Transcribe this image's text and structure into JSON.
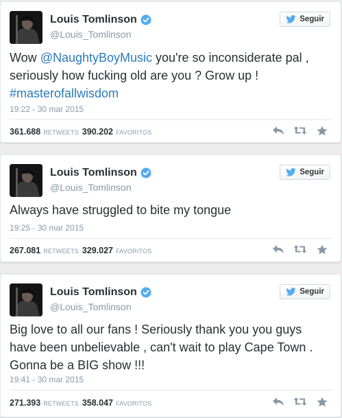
{
  "colors": {
    "link": "#2b7bb9",
    "verified_badge": "#55acee",
    "bird_icon": "#55acee",
    "muted_text": "#8899a6",
    "action_icons": "#8899a6"
  },
  "tweets": [
    {
      "author_name": "Louis Tomlinson",
      "handle": "@Louis_Tomlinson",
      "follow_label": "Seguir",
      "text_parts": {
        "t1": "Wow ",
        "mention": "@NaughtyBoyMusic",
        "t2": " you're so inconsiderate pal , seriously how fucking old are you ? Grow up ! ",
        "hashtag": "#masterofallwisdom"
      },
      "timestamp": "19:22 - 30 mar 2015",
      "retweets": "361.688",
      "retweets_label": "RETWEETS",
      "favorites": "390.202",
      "favorites_label": "FAVORITOS"
    },
    {
      "author_name": "Louis Tomlinson",
      "handle": "@Louis_Tomlinson",
      "follow_label": "Seguir",
      "text": "Always have struggled to bite my tongue",
      "timestamp": "19:25 - 30 mar 2015",
      "retweets": "267.081",
      "retweets_label": "RETWEETS",
      "favorites": "329.027",
      "favorites_label": "FAVORITOS"
    },
    {
      "author_name": "Louis Tomlinson",
      "handle": "@Louis_Tomlinson",
      "follow_label": "Seguir",
      "text": "Big love to all our fans ! Seriously thank you you guys have been unbelievable , can't wait to play Cape Town . Gonna be a BIG show !!!",
      "timestamp": "19:41 - 30 mar 2015",
      "retweets": "271.393",
      "retweets_label": "RETWEETS",
      "favorites": "358.047",
      "favorites_label": "FAVORITOS"
    }
  ]
}
